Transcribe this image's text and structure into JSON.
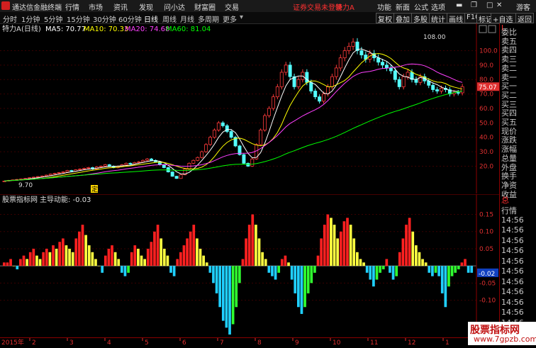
{
  "titlebar": {
    "app_name": "通达信金融终端",
    "menus": [
      "行情",
      "市场",
      "资讯",
      "发现",
      "问小达",
      "财富圈",
      "交易"
    ],
    "warning": "证券交易未登录",
    "stock": "特力A",
    "right_items": [
      "功能",
      "新面",
      "公式",
      "选项"
    ],
    "user": "游客"
  },
  "periodbar": {
    "periods": [
      "分时",
      "1分钟",
      "5分钟",
      "15分钟",
      "30分钟",
      "60分钟",
      "日线",
      "周线",
      "月线",
      "多周期",
      "更多"
    ],
    "active_period": "日线",
    "tools": [
      "复权",
      "叠加",
      "多股",
      "统计",
      "画线",
      "F10",
      "标记",
      "+自选",
      "返回"
    ]
  },
  "main_chart": {
    "stock_label": "特力A",
    "cycle_label": "(日线)",
    "ma": [
      {
        "label": "MA5: 70.77",
        "color": "#ffffff"
      },
      {
        "label": "MA10: 70.33",
        "color": "#ffff00"
      },
      {
        "label": "MA20: 74.68",
        "color": "#ff40ff"
      },
      {
        "label": "MA60: 81.04",
        "color": "#00ff00"
      }
    ],
    "high_annotation": "108.00",
    "low_annotation": "9.70",
    "marker": "定",
    "price_ticks": [
      "100.0",
      "90.0",
      "80.0",
      "70.0",
      "60.0",
      "50.0",
      "40.0",
      "30.0",
      "20.0"
    ],
    "last_price": "75.07"
  },
  "indicator": {
    "name": "股票指标网",
    "series_label": "主导动能: -0.03",
    "ticks": [
      "0.15",
      "0.10",
      "0.05",
      "-0.05",
      "-0.10"
    ],
    "last_value": "-0.02"
  },
  "axis": {
    "year": "2015年",
    "months": [
      "2",
      "3",
      "4",
      "5",
      "6",
      "7",
      "8",
      "9",
      "10",
      "11",
      "12",
      "1"
    ]
  },
  "sidepanel": {
    "items_top": [
      "委比",
      "卖五",
      "卖四",
      "卖三",
      "卖二",
      "卖一",
      "买一",
      "买二",
      "买三",
      "买四",
      "买五",
      "现价",
      "涨跌",
      "涨幅",
      "总量",
      "外盘",
      "换手",
      "净资",
      "收益"
    ],
    "items_bottom": [
      "行情",
      "14:56",
      "14:56",
      "14:56",
      "14:56",
      "14:56",
      "14:56",
      "14:56",
      "14:56",
      "14:56",
      "14:56",
      "14:56",
      "14:56"
    ],
    "corner_top": "L",
    "corner_bottom": "总"
  },
  "watermark": {
    "line1": "股票指标网",
    "line2": "www.7gpzb.com"
  },
  "chart_data": [
    {
      "type": "candlestick",
      "title": "特力A (日线)",
      "ylim": [
        5,
        112
      ],
      "ma_series": [
        "MA5",
        "MA10",
        "MA20",
        "MA60"
      ],
      "close": [
        9.7,
        10.2,
        10.5,
        10.8,
        11.2,
        11.5,
        12,
        12.4,
        12.8,
        13.2,
        13.8,
        14.5,
        15,
        15.5,
        16,
        17,
        16.5,
        17.5,
        18,
        18.5,
        19,
        18,
        19.5,
        20,
        21,
        20,
        19,
        20,
        21,
        22,
        21.5,
        22.5,
        23,
        24,
        25,
        24,
        23,
        21,
        19,
        16,
        13,
        11.5,
        14,
        18,
        22,
        24,
        26,
        30,
        35,
        40,
        45,
        50,
        48,
        44,
        40,
        34,
        28,
        22,
        20,
        25,
        35,
        45,
        55,
        60,
        68,
        75,
        85,
        90,
        82,
        75,
        80,
        85,
        78,
        72,
        68,
        65,
        70,
        75,
        82,
        88,
        95,
        100,
        103,
        106,
        100,
        97,
        94,
        98,
        95,
        92,
        90,
        88,
        86,
        80,
        75,
        82,
        85,
        80,
        78,
        82,
        79,
        76,
        73,
        72,
        74,
        73,
        70,
        71,
        70.8,
        75.07
      ],
      "low": 9.7,
      "high": 108.0
    },
    {
      "type": "bar",
      "title": "主导动能",
      "ylim": [
        -0.2,
        0.18
      ],
      "values": [
        0.01,
        0.01,
        0.02,
        0.0,
        -0.01,
        0.02,
        0.03,
        0.02,
        0.04,
        0.05,
        0.03,
        0.02,
        0.04,
        0.05,
        0.04,
        0.06,
        0.05,
        0.07,
        0.08,
        0.06,
        0.05,
        0.04,
        0.08,
        0.1,
        0.12,
        0.09,
        0.06,
        0.04,
        0.02,
        0.0,
        -0.02,
        0.03,
        0.05,
        0.06,
        0.04,
        0.02,
        -0.02,
        -0.03,
        -0.02,
        0.04,
        0.06,
        0.05,
        0.03,
        0.02,
        0.05,
        0.07,
        0.1,
        0.12,
        0.08,
        0.05,
        0.03,
        -0.02,
        -0.03,
        0.02,
        0.04,
        0.06,
        0.08,
        0.1,
        0.12,
        0.08,
        0.05,
        0.03,
        0.01,
        -0.02,
        -0.05,
        -0.08,
        -0.12,
        -0.16,
        -0.18,
        -0.2,
        -0.17,
        -0.12,
        -0.05,
        0.02,
        0.08,
        0.12,
        0.15,
        0.12,
        0.08,
        0.04,
        0.02,
        -0.02,
        -0.03,
        -0.04,
        -0.02,
        0.02,
        0.03,
        0.01,
        -0.04,
        -0.08,
        -0.12,
        -0.14,
        -0.12,
        -0.08,
        -0.05,
        -0.02,
        0.03,
        0.08,
        0.12,
        0.15,
        0.14,
        0.12,
        0.08,
        0.1,
        0.13,
        0.14,
        0.12,
        0.08,
        0.04,
        0.02,
        0.01,
        -0.02,
        -0.04,
        -0.06,
        -0.04,
        -0.02,
        -0.01,
        0.02,
        -0.02,
        -0.04,
        -0.03,
        0.04,
        0.08,
        0.12,
        0.14,
        0.1,
        0.06,
        0.04,
        0.02,
        0.01,
        -0.02,
        -0.03,
        -0.02,
        -0.03,
        -0.08,
        -0.12,
        -0.06,
        -0.03,
        -0.02,
        -0.01,
        0.01,
        0.02,
        -0.02,
        -0.02
      ]
    }
  ]
}
